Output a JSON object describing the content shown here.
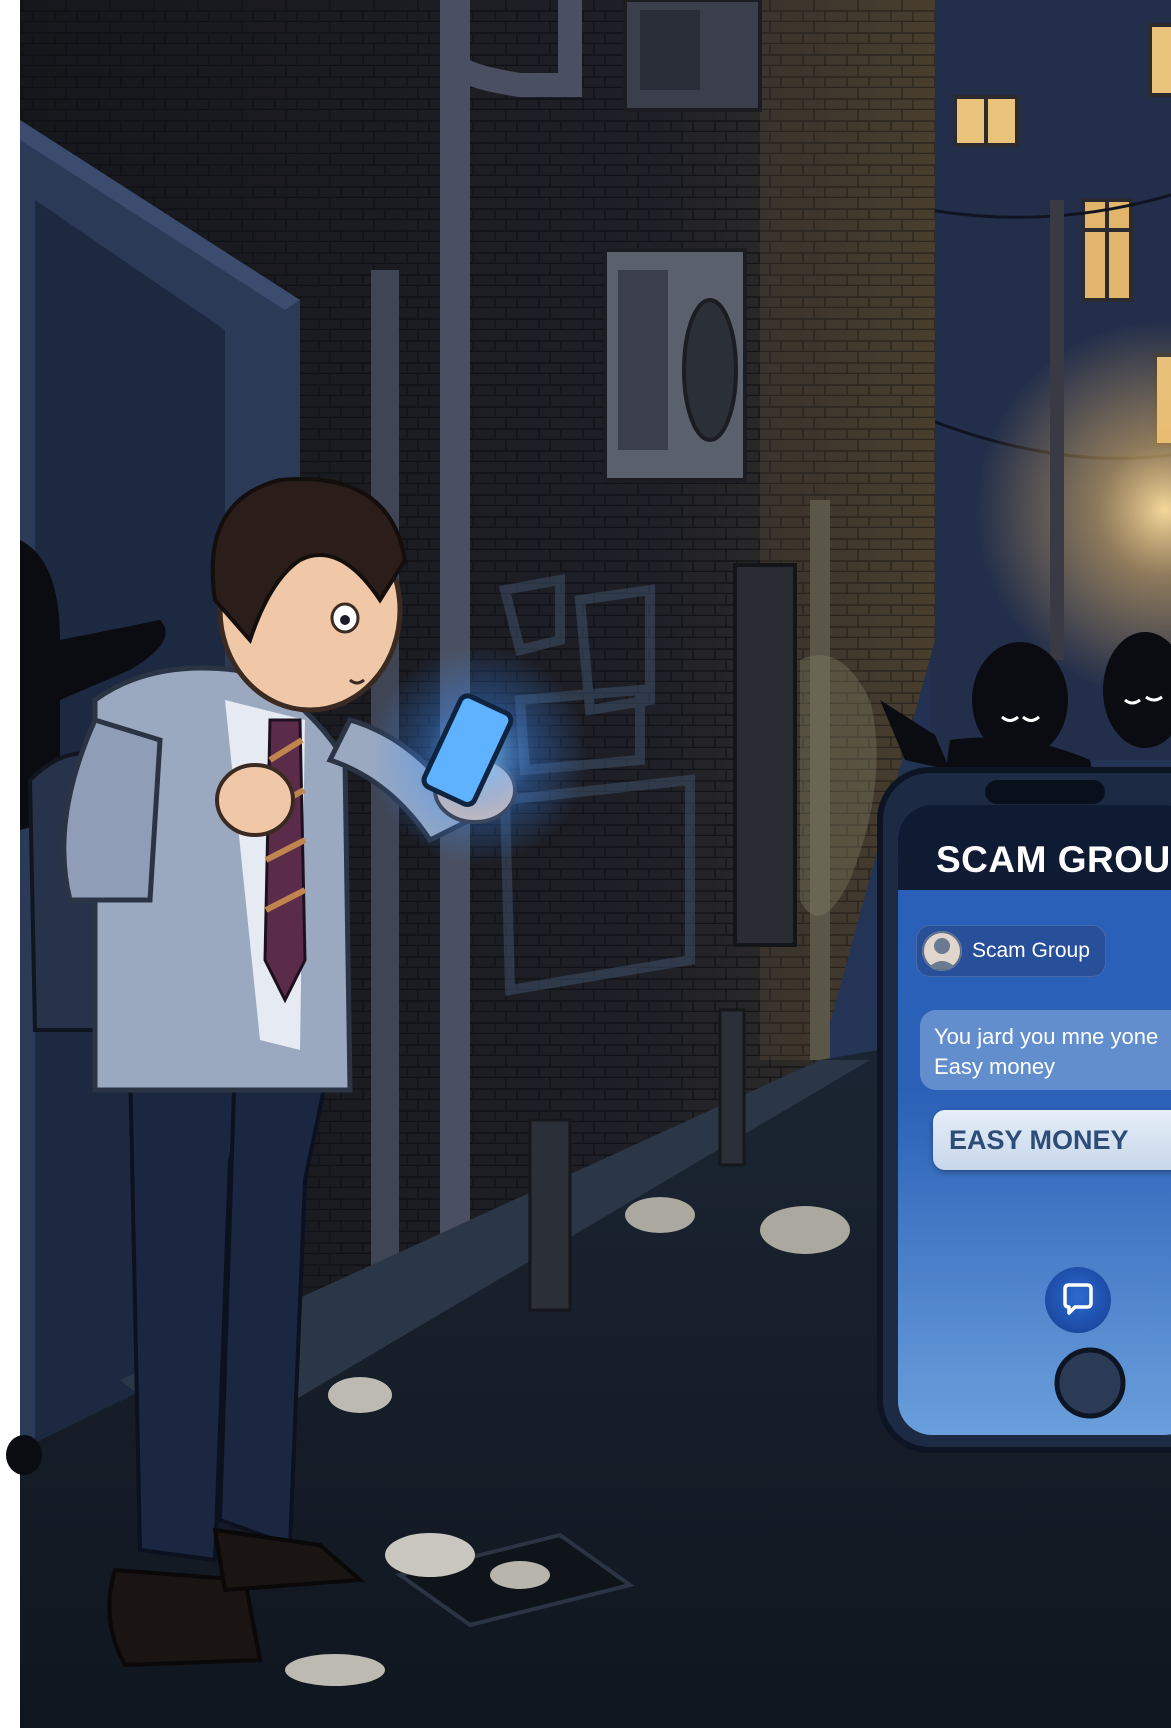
{
  "scene": {
    "colors": {
      "night_sky": "#1b2a4a",
      "brick_wall": "#1c1d24",
      "phone_glow": "#4aa3ff",
      "street_light": "#f3c26a",
      "window_light": "#e9c27c"
    },
    "wall_graffiti": {
      "text": ""
    }
  },
  "phone": {
    "title": "SCAM GROUP",
    "contact_name": "Scam Group",
    "message_line1": "You jard you mne yone",
    "message_line2": "Easy money",
    "cta_label": "EASY MONEY",
    "icons": {
      "contact": "user-avatar-icon",
      "chat": "chat-bubble-icon",
      "home": "home-button-icon"
    }
  }
}
